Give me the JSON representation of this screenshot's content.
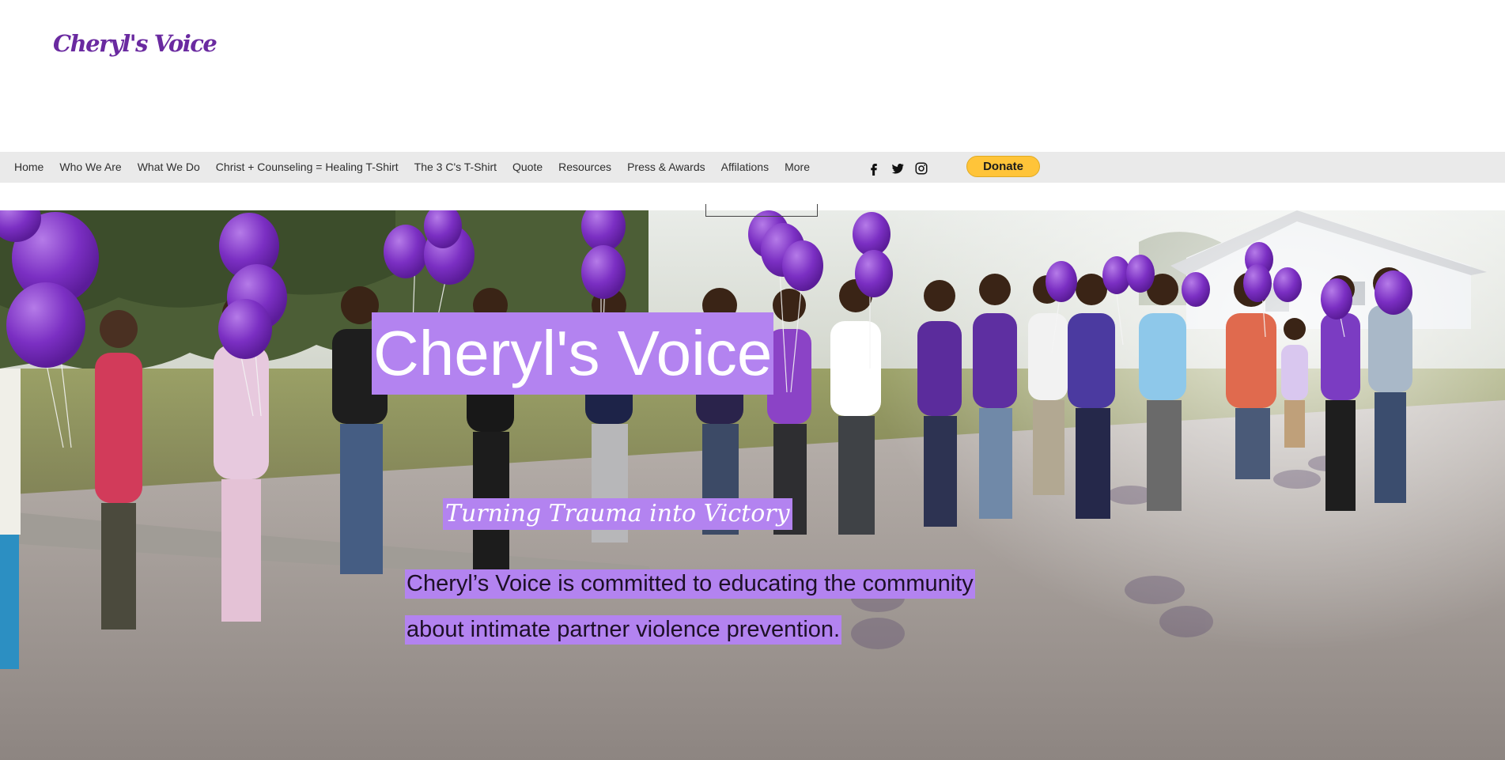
{
  "header": {
    "logo_text": "Cheryl's Voice"
  },
  "nav": {
    "items": [
      {
        "label": "Home"
      },
      {
        "label": "Who We Are"
      },
      {
        "label": "What We Do"
      },
      {
        "label": "Christ + Counseling = Healing T-Shirt"
      },
      {
        "label": "The 3 C's T-Shirt"
      },
      {
        "label": "Quote"
      },
      {
        "label": "Resources"
      },
      {
        "label": "Press & Awards"
      },
      {
        "label": "Affilations"
      },
      {
        "label": "More"
      }
    ]
  },
  "social": {
    "icons": [
      "facebook-icon",
      "twitter-icon",
      "instagram-icon"
    ]
  },
  "donate": {
    "label": "Donate",
    "color": "#ffc439"
  },
  "hero": {
    "title": "Cheryl's Voice",
    "tagline": "Turning Trauma into Victory",
    "description_line1": "Cheryl’s Voice is committed to educating the community",
    "description_line2": "about intimate partner violence prevention. ",
    "highlight_color": "#b383f0",
    "image_description": "Group of people holding hands in a line outdoors with purple balloons"
  },
  "colors": {
    "brand_purple": "#6a2aa0",
    "nav_background": "#eaeaea"
  }
}
